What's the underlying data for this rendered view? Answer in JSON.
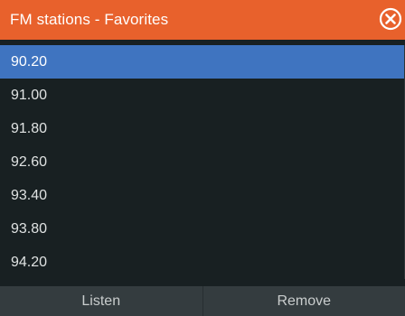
{
  "dialog": {
    "title": "FM stations - Favorites",
    "close_icon": "close-circle-icon"
  },
  "stations": [
    {
      "freq": "90.20",
      "selected": true
    },
    {
      "freq": "91.00",
      "selected": false
    },
    {
      "freq": "91.80",
      "selected": false
    },
    {
      "freq": "92.60",
      "selected": false
    },
    {
      "freq": "93.40",
      "selected": false
    },
    {
      "freq": "93.80",
      "selected": false
    },
    {
      "freq": "94.20",
      "selected": false
    }
  ],
  "buttons": {
    "listen_label": "Listen",
    "remove_label": "Remove"
  },
  "colors": {
    "title_bar": "#e8612c",
    "selection": "#3f74c0",
    "background": "#182022",
    "button_bar": "#343c3f"
  }
}
